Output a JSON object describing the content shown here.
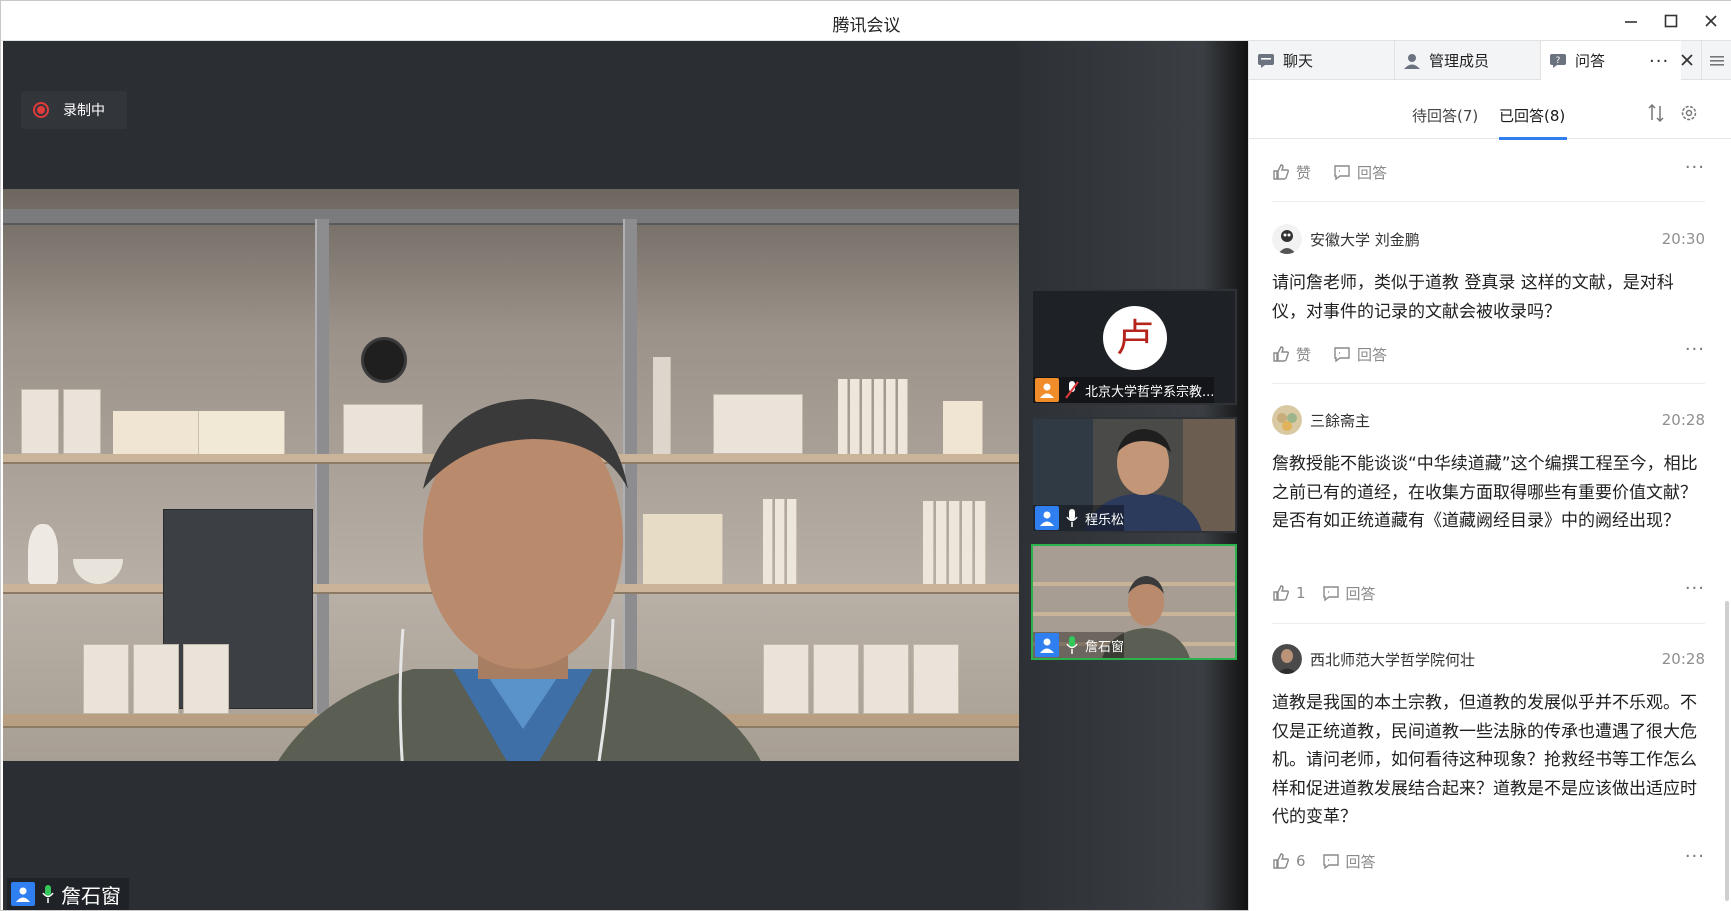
{
  "window": {
    "title": "腾讯会议"
  },
  "recording": {
    "label": "录制中"
  },
  "speaker": {
    "name": "詹石窗"
  },
  "thumbnails": [
    {
      "name": "北京大学哲学系宗教..."
    },
    {
      "name": "程乐松"
    },
    {
      "name": "詹石窗"
    }
  ],
  "panel": {
    "tabs": [
      {
        "label": "聊天"
      },
      {
        "label": "管理成员"
      },
      {
        "label": "问答"
      }
    ],
    "subtabs": [
      {
        "label": "待回答(7)"
      },
      {
        "label": "已回答(8)"
      }
    ]
  },
  "qa": {
    "top_item": {
      "like_label": "赞",
      "reply_label": "回答"
    },
    "items": [
      {
        "author": "安徽大学 刘金鹏",
        "time": "20:30",
        "text": "请问詹老师，类似于道教 登真录 这样的文献，是对科仪，对事件的记录的文献会被收录吗？",
        "likes": "赞",
        "reply_label": "回答"
      },
      {
        "author": "三餘斋主",
        "time": "20:28",
        "text": "詹教授能不能谈谈“中华续道藏”这个编撰工程至今，相比之前已有的道经，在收集方面取得哪些有重要价值文献？是否有如正统道藏有《道藏阙经目录》中的阙经出现？",
        "likes": "1",
        "reply_label": "回答"
      },
      {
        "author": "西北师范大学哲学院何壮",
        "time": "20:28",
        "text": "道教是我国的本土宗教，但道教的发展似乎并不乐观。不仅是正统道教，民间道教一些法脉的传承也遭遇了很大危机。请问老师，如何看待这种现象？抢救经书等工作怎么样和促进道教发展结合起来？道教是不是应该做出适应时代的变革？",
        "likes": "6",
        "reply_label": "回答"
      }
    ]
  },
  "icons": {
    "chat": "chat-bubble-icon",
    "members": "person-icon",
    "qa": "qa-icon",
    "sort": "sort-icon",
    "settings": "gear-icon",
    "like": "thumbs-up-icon",
    "reply": "comment-icon",
    "more": "more-dots-icon"
  },
  "colors": {
    "accent": "#2f7ff0",
    "active_border": "#2bb24c",
    "recording": "#e03b3b"
  }
}
